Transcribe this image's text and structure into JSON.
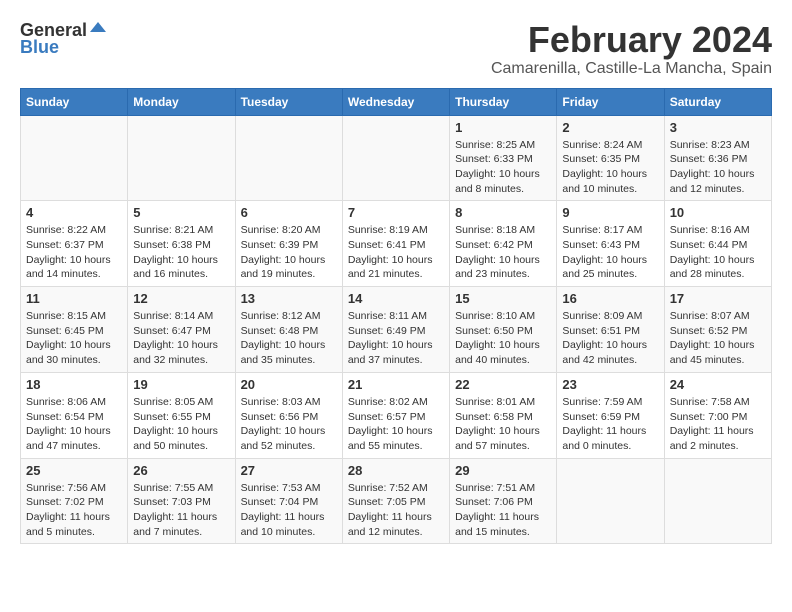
{
  "header": {
    "logo_general": "General",
    "logo_blue": "Blue",
    "month_title": "February 2024",
    "location": "Camarenilla, Castille-La Mancha, Spain"
  },
  "calendar": {
    "days_of_week": [
      "Sunday",
      "Monday",
      "Tuesday",
      "Wednesday",
      "Thursday",
      "Friday",
      "Saturday"
    ],
    "weeks": [
      [
        {
          "day": "",
          "info": ""
        },
        {
          "day": "",
          "info": ""
        },
        {
          "day": "",
          "info": ""
        },
        {
          "day": "",
          "info": ""
        },
        {
          "day": "1",
          "info": "Sunrise: 8:25 AM\nSunset: 6:33 PM\nDaylight: 10 hours and 8 minutes."
        },
        {
          "day": "2",
          "info": "Sunrise: 8:24 AM\nSunset: 6:35 PM\nDaylight: 10 hours and 10 minutes."
        },
        {
          "day": "3",
          "info": "Sunrise: 8:23 AM\nSunset: 6:36 PM\nDaylight: 10 hours and 12 minutes."
        }
      ],
      [
        {
          "day": "4",
          "info": "Sunrise: 8:22 AM\nSunset: 6:37 PM\nDaylight: 10 hours and 14 minutes."
        },
        {
          "day": "5",
          "info": "Sunrise: 8:21 AM\nSunset: 6:38 PM\nDaylight: 10 hours and 16 minutes."
        },
        {
          "day": "6",
          "info": "Sunrise: 8:20 AM\nSunset: 6:39 PM\nDaylight: 10 hours and 19 minutes."
        },
        {
          "day": "7",
          "info": "Sunrise: 8:19 AM\nSunset: 6:41 PM\nDaylight: 10 hours and 21 minutes."
        },
        {
          "day": "8",
          "info": "Sunrise: 8:18 AM\nSunset: 6:42 PM\nDaylight: 10 hours and 23 minutes."
        },
        {
          "day": "9",
          "info": "Sunrise: 8:17 AM\nSunset: 6:43 PM\nDaylight: 10 hours and 25 minutes."
        },
        {
          "day": "10",
          "info": "Sunrise: 8:16 AM\nSunset: 6:44 PM\nDaylight: 10 hours and 28 minutes."
        }
      ],
      [
        {
          "day": "11",
          "info": "Sunrise: 8:15 AM\nSunset: 6:45 PM\nDaylight: 10 hours and 30 minutes."
        },
        {
          "day": "12",
          "info": "Sunrise: 8:14 AM\nSunset: 6:47 PM\nDaylight: 10 hours and 32 minutes."
        },
        {
          "day": "13",
          "info": "Sunrise: 8:12 AM\nSunset: 6:48 PM\nDaylight: 10 hours and 35 minutes."
        },
        {
          "day": "14",
          "info": "Sunrise: 8:11 AM\nSunset: 6:49 PM\nDaylight: 10 hours and 37 minutes."
        },
        {
          "day": "15",
          "info": "Sunrise: 8:10 AM\nSunset: 6:50 PM\nDaylight: 10 hours and 40 minutes."
        },
        {
          "day": "16",
          "info": "Sunrise: 8:09 AM\nSunset: 6:51 PM\nDaylight: 10 hours and 42 minutes."
        },
        {
          "day": "17",
          "info": "Sunrise: 8:07 AM\nSunset: 6:52 PM\nDaylight: 10 hours and 45 minutes."
        }
      ],
      [
        {
          "day": "18",
          "info": "Sunrise: 8:06 AM\nSunset: 6:54 PM\nDaylight: 10 hours and 47 minutes."
        },
        {
          "day": "19",
          "info": "Sunrise: 8:05 AM\nSunset: 6:55 PM\nDaylight: 10 hours and 50 minutes."
        },
        {
          "day": "20",
          "info": "Sunrise: 8:03 AM\nSunset: 6:56 PM\nDaylight: 10 hours and 52 minutes."
        },
        {
          "day": "21",
          "info": "Sunrise: 8:02 AM\nSunset: 6:57 PM\nDaylight: 10 hours and 55 minutes."
        },
        {
          "day": "22",
          "info": "Sunrise: 8:01 AM\nSunset: 6:58 PM\nDaylight: 10 hours and 57 minutes."
        },
        {
          "day": "23",
          "info": "Sunrise: 7:59 AM\nSunset: 6:59 PM\nDaylight: 11 hours and 0 minutes."
        },
        {
          "day": "24",
          "info": "Sunrise: 7:58 AM\nSunset: 7:00 PM\nDaylight: 11 hours and 2 minutes."
        }
      ],
      [
        {
          "day": "25",
          "info": "Sunrise: 7:56 AM\nSunset: 7:02 PM\nDaylight: 11 hours and 5 minutes."
        },
        {
          "day": "26",
          "info": "Sunrise: 7:55 AM\nSunset: 7:03 PM\nDaylight: 11 hours and 7 minutes."
        },
        {
          "day": "27",
          "info": "Sunrise: 7:53 AM\nSunset: 7:04 PM\nDaylight: 11 hours and 10 minutes."
        },
        {
          "day": "28",
          "info": "Sunrise: 7:52 AM\nSunset: 7:05 PM\nDaylight: 11 hours and 12 minutes."
        },
        {
          "day": "29",
          "info": "Sunrise: 7:51 AM\nSunset: 7:06 PM\nDaylight: 11 hours and 15 minutes."
        },
        {
          "day": "",
          "info": ""
        },
        {
          "day": "",
          "info": ""
        }
      ]
    ]
  }
}
